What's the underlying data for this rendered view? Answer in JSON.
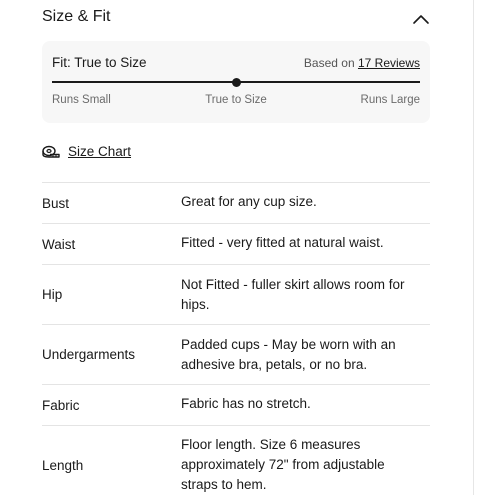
{
  "header": {
    "title": "Size & Fit",
    "toggle_icon": "chevron-up-icon"
  },
  "fit": {
    "label": "Fit: True to Size",
    "reviews_prefix": "Based on",
    "reviews_link": "17 Reviews",
    "scale": {
      "left": "Runs Small",
      "middle": "True to Size",
      "right": "Runs Large",
      "position": 0.5
    }
  },
  "size_chart": {
    "label": "Size Chart",
    "icon": "measuring-tape-icon"
  },
  "specs": [
    {
      "key": "Bust",
      "value": "Great for any cup size."
    },
    {
      "key": "Waist",
      "value": "Fitted - very fitted at natural waist."
    },
    {
      "key": "Hip",
      "value": "Not Fitted - fuller skirt allows room for hips."
    },
    {
      "key": "Undergarments",
      "value": "Padded cups - May be worn with an adhesive bra, petals, or no bra."
    },
    {
      "key": "Fabric",
      "value": "Fabric has no stretch."
    },
    {
      "key": "Length",
      "value": "Floor length. Size 6 measures approximately 72\" from adjustable straps to hem."
    }
  ]
}
